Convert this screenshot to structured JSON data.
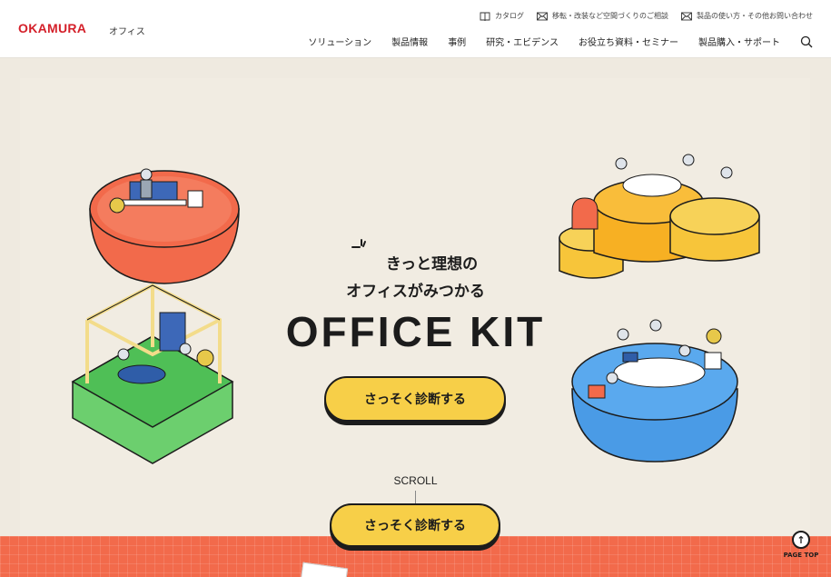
{
  "header": {
    "logo": "OKAMURA",
    "logo_sub": "オフィス",
    "utility": [
      {
        "icon": "book-icon",
        "label": "カタログ"
      },
      {
        "icon": "mail-icon",
        "label": "移転・改装など空間づくりのご相談"
      },
      {
        "icon": "mail-icon",
        "label": "製品の使い方・その他お問い合わせ"
      }
    ],
    "nav": [
      "ソリューション",
      "製品情報",
      "事例",
      "研究・エビデンス",
      "お役立ち資料・セミナー",
      "製品購入・サポート"
    ]
  },
  "hero": {
    "tagline_1": "きっと理想の",
    "tagline_2": "オフィスがみつかる",
    "brand": "OFFICE KIT",
    "cta": "さっそく診断する",
    "scroll": "SCROLL",
    "cta_sticky": "さっそく診断する"
  },
  "page_top": "PAGE TOP",
  "colors": {
    "accent_yellow": "#f7cf48",
    "band_orange": "#f26a4b",
    "logo_red": "#d4202a",
    "island_red": "#f26a4b",
    "island_green": "#6ccf6e",
    "island_yellow": "#f7c53a",
    "island_blue": "#4a9be6"
  }
}
